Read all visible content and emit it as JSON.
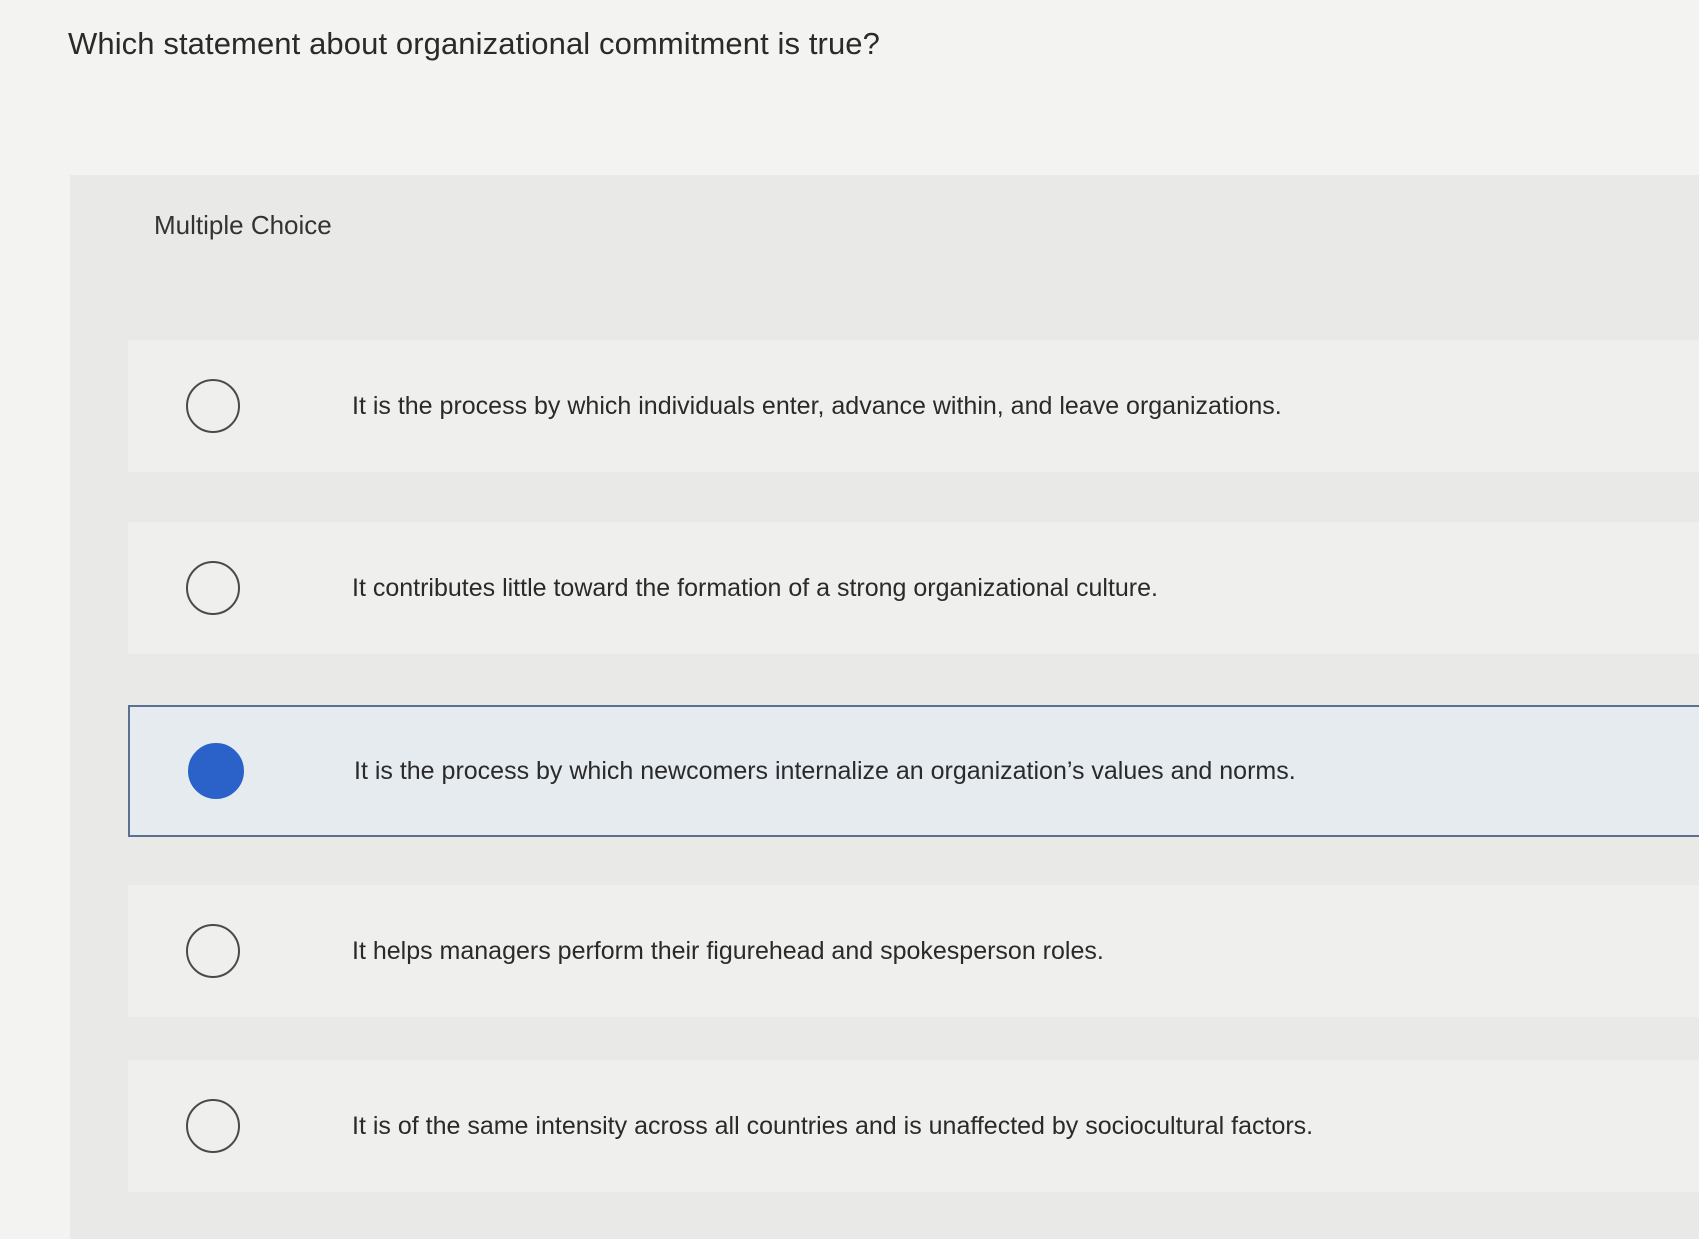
{
  "question": {
    "text": "Which statement about organizational commitment is true?"
  },
  "panel": {
    "label": "Multiple Choice"
  },
  "options": [
    {
      "text": "It is the process by which individuals enter, advance within, and leave organizations.",
      "selected": false
    },
    {
      "text": "It contributes little toward the formation of a strong organizational culture.",
      "selected": false
    },
    {
      "text": "It is the process by which newcomers internalize an organization’s values and norms.",
      "selected": true
    },
    {
      "text": "It helps managers perform their figurehead and spokesperson roles.",
      "selected": false
    },
    {
      "text": "It is of the same intensity across all countries and is unaffected by sociocultural factors.",
      "selected": false
    }
  ],
  "colors": {
    "selected_fill": "#2a62c9",
    "selected_border": "#5a7191",
    "selected_background": "#e6ebf0"
  }
}
